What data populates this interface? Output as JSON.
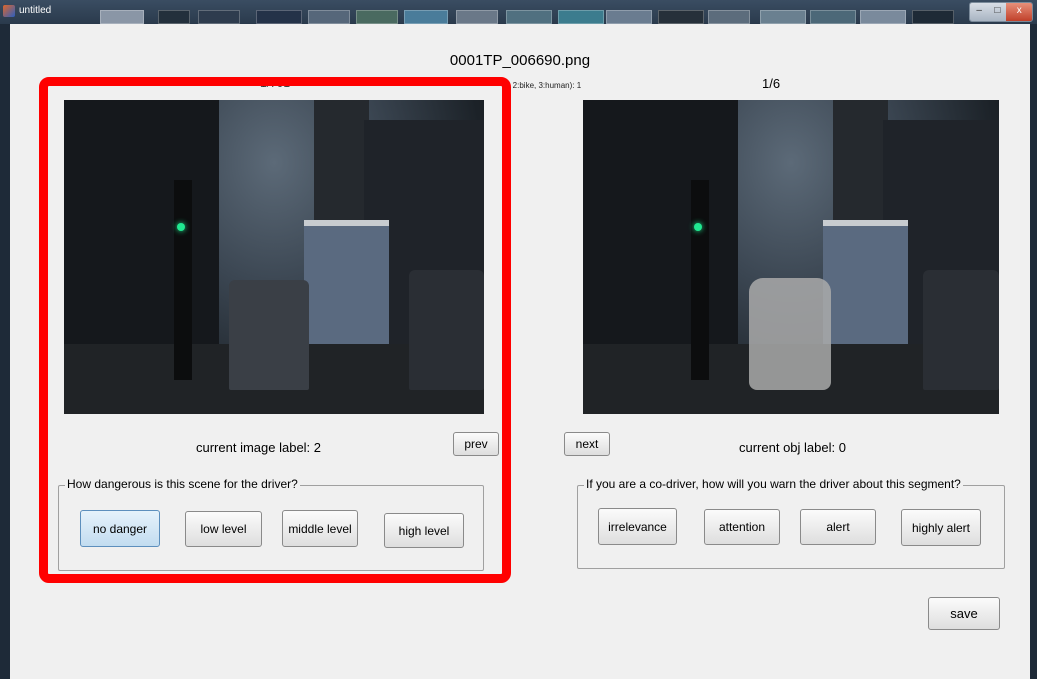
{
  "window": {
    "title": "untitled",
    "minimize_glyph": "–",
    "maximize_glyph": "□",
    "close_glyph": "x"
  },
  "header": {
    "file_name": "0001TP_006690.png",
    "left_counter": "1/701",
    "type_prompt": "r, 2:bike, 3:human): 1",
    "right_counter": "1/6"
  },
  "left_panel": {
    "image_icon": "street-scene-image",
    "label_text": "current image label: 2",
    "prev_label": "prev",
    "group_title": "How dangerous is this scene for the driver?",
    "buttons": [
      "no danger",
      "low level",
      "middle level",
      "high level"
    ],
    "selected": "no danger"
  },
  "right_panel": {
    "image_icon": "segmented-scene-image",
    "next_label": "next",
    "label_text": "current obj label: 0",
    "group_title": "If you are a co-driver, how will you warn the driver about this segment?",
    "buttons": [
      "irrelevance",
      "attention",
      "alert",
      "highly alert"
    ]
  },
  "save_label": "save",
  "colors": {
    "highlight": "#ff0000",
    "panel_background": "#f0f0f0",
    "selected_button": "#c2dcf0"
  }
}
